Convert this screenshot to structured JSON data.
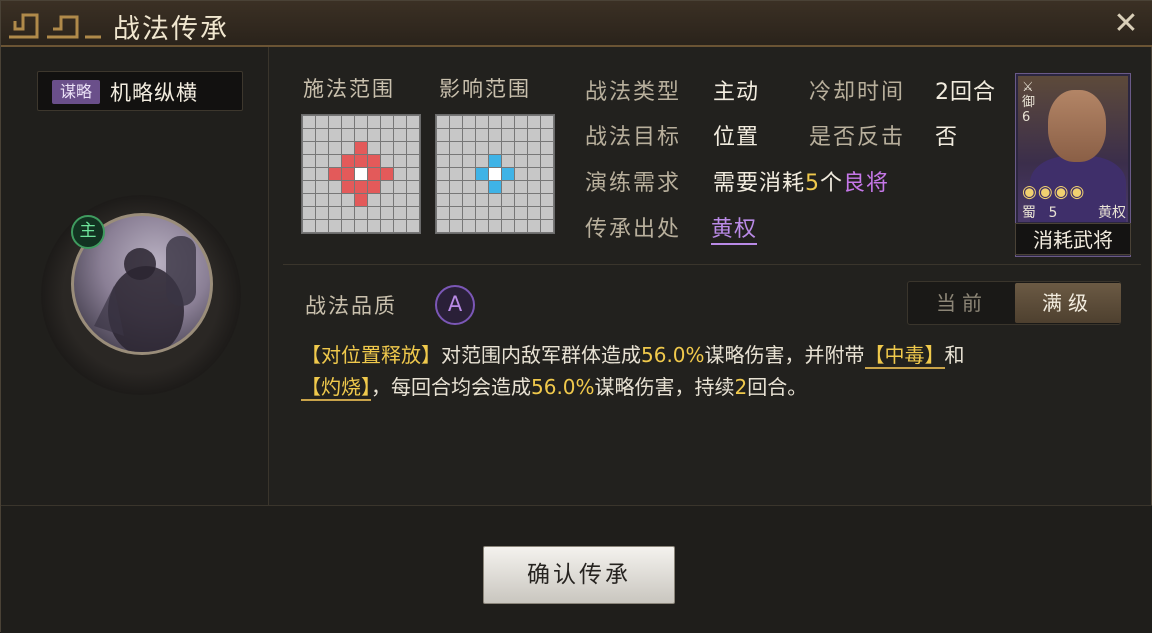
{
  "window": {
    "title": "战法传承",
    "close_label": "✕"
  },
  "skill": {
    "category": "谋略",
    "name": "机略纵横",
    "role_badge": "主"
  },
  "range": {
    "cast_label": "施法范围",
    "effect_label": "影响范围"
  },
  "info": {
    "type_label": "战法类型",
    "type_value": "主动",
    "cooldown_label": "冷却时间",
    "cooldown_value": "2回合",
    "target_label": "战法目标",
    "target_value": "位置",
    "counter_label": "是否反击",
    "counter_value": "否",
    "req_label": "演练需求",
    "req_prefix": "需要消耗",
    "req_count": "5",
    "req_unit": "个",
    "req_type": "良将",
    "source_label": "传承出处",
    "source_value": "黄权"
  },
  "card": {
    "unit_icon": "⚔",
    "troop": "御",
    "cost": "6",
    "stars": "◉◉◉◉",
    "faction": "蜀",
    "level": "5",
    "name": "黄权",
    "caption": "消耗武将"
  },
  "quality": {
    "label": "战法品质",
    "grade": "A"
  },
  "toggle": {
    "current": "当前",
    "max": "满级"
  },
  "description": {
    "trigger": "【对位置释放】",
    "t1": "对范围内敌军群体造成",
    "pct1": "56.0%",
    "t2": "谋略伤害，并附带",
    "status1": "【中毒】",
    "t3": "和",
    "status2": "【灼烧】",
    "t4": "，每回合均会造成",
    "pct2": "56.0%",
    "t5": "谋略伤害，持续",
    "turns": "2",
    "t6": "回合。"
  },
  "confirm_label": "确认传承",
  "colors": {
    "accent_red": "#e35a5a",
    "accent_blue": "#3fb3e6",
    "quality_purple": "#b98ae6",
    "highlight_yellow": "#f0c94c"
  }
}
